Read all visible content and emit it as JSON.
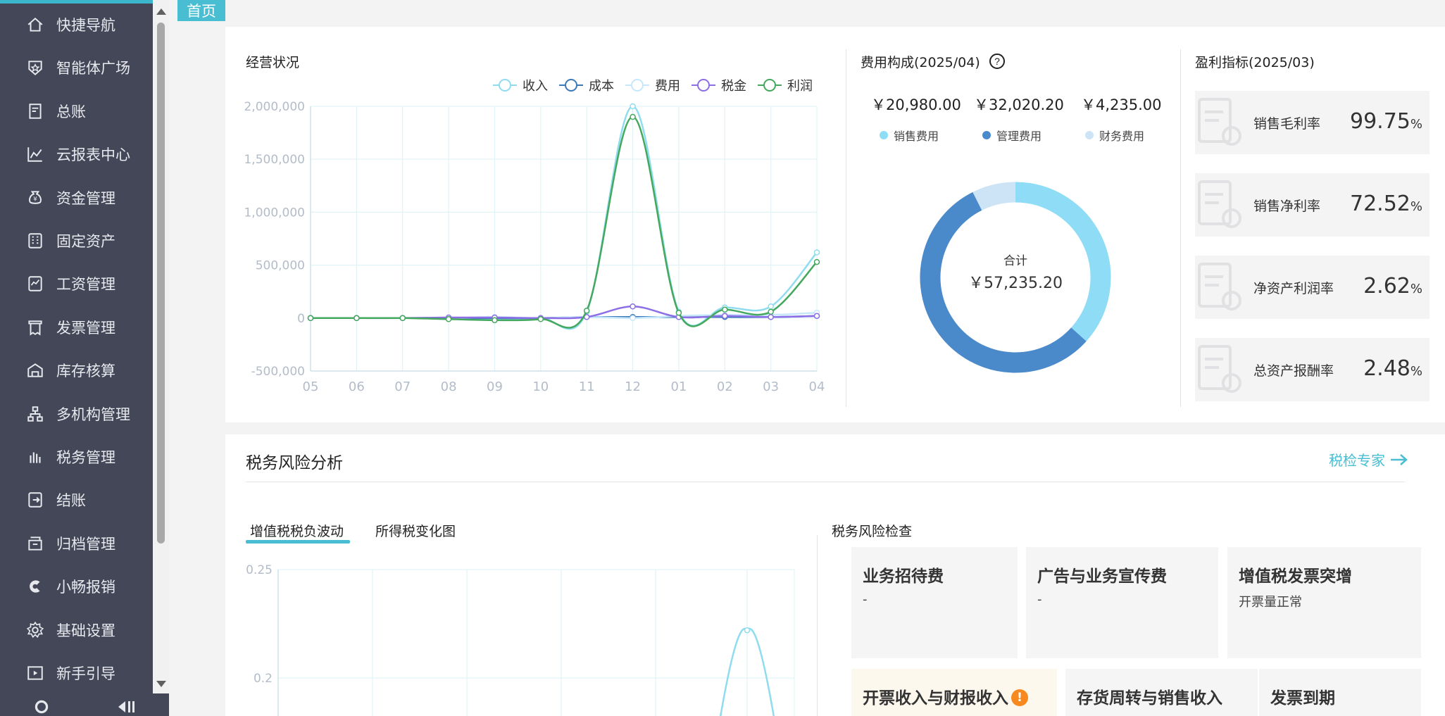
{
  "sidebar": {
    "items": [
      {
        "label": "快捷导航",
        "icon": "home-icon"
      },
      {
        "label": "智能体广场",
        "icon": "star-shield-icon"
      },
      {
        "label": "总账",
        "icon": "ledger-icon"
      },
      {
        "label": "云报表中心",
        "icon": "chart-line-icon"
      },
      {
        "label": "资金管理",
        "icon": "money-bag-icon"
      },
      {
        "label": "固定资产",
        "icon": "building-icon"
      },
      {
        "label": "工资管理",
        "icon": "payroll-icon"
      },
      {
        "label": "发票管理",
        "icon": "invoice-icon"
      },
      {
        "label": "库存核算",
        "icon": "warehouse-icon"
      },
      {
        "label": "多机构管理",
        "icon": "org-chart-icon"
      },
      {
        "label": "税务管理",
        "icon": "tax-hand-icon"
      },
      {
        "label": "结账",
        "icon": "checkout-icon"
      },
      {
        "label": "归档管理",
        "icon": "archive-icon"
      },
      {
        "label": "小畅报销",
        "icon": "reimburse-icon"
      },
      {
        "label": "基础设置",
        "icon": "settings-icon"
      },
      {
        "label": "新手引导",
        "icon": "video-guide-icon"
      }
    ]
  },
  "tabs": {
    "home": "首页"
  },
  "business": {
    "title": "经营状况",
    "chart_data": {
      "type": "line",
      "categories": [
        "05",
        "06",
        "07",
        "08",
        "09",
        "10",
        "11",
        "12",
        "01",
        "02",
        "03",
        "04"
      ],
      "y_ticks": [
        "2,000,000",
        "1,500,000",
        "1,000,000",
        "500,000",
        "0",
        "-500,000"
      ],
      "ylim": [
        -500000,
        2000000
      ],
      "series": [
        {
          "name": "收入",
          "color": "#8fdcef",
          "values": [
            0,
            0,
            0,
            0,
            -10000,
            0,
            60000,
            2000000,
            60000,
            100000,
            110000,
            620000
          ]
        },
        {
          "name": "成本",
          "color": "#3b79b9",
          "values": [
            0,
            0,
            0,
            0,
            0,
            0,
            10000,
            10000,
            10000,
            10000,
            10000,
            20000
          ]
        },
        {
          "name": "费用",
          "color": "#c6e7fb",
          "values": [
            0,
            0,
            0,
            0,
            10000,
            0,
            10000,
            0,
            20000,
            30000,
            30000,
            50000
          ]
        },
        {
          "name": "税金",
          "color": "#8c6fe6",
          "values": [
            0,
            0,
            0,
            5000,
            5000,
            0,
            10000,
            110000,
            10000,
            20000,
            10000,
            20000
          ]
        },
        {
          "name": "利润",
          "color": "#44a85e",
          "values": [
            0,
            0,
            0,
            -10000,
            -20000,
            -10000,
            70000,
            1900000,
            50000,
            80000,
            60000,
            530000
          ]
        }
      ]
    }
  },
  "fee": {
    "title": "费用构成(2025/04)",
    "values": [
      "￥20,980.00",
      "￥32,020.20",
      "￥4,235.00"
    ],
    "legend": [
      "销售费用",
      "管理费用",
      "财务费用"
    ],
    "total_label": "合计",
    "total_value": "￥57,235.20",
    "chart_data": {
      "type": "pie",
      "labels": [
        "销售费用",
        "管理费用",
        "财务费用"
      ],
      "values": [
        20980.0,
        32020.2,
        4235.0
      ],
      "colors": [
        "#8fdcf7",
        "#4a8acb",
        "#cde4f7"
      ]
    }
  },
  "profit": {
    "title": "盈利指标(2025/03)",
    "cards": [
      {
        "name": "销售毛利率",
        "value": "99.75",
        "unit": "%"
      },
      {
        "name": "销售净利率",
        "value": "72.52",
        "unit": "%"
      },
      {
        "name": "净资产利润率",
        "value": "2.62",
        "unit": "%"
      },
      {
        "name": "总资产报酬率",
        "value": "2.48",
        "unit": "%"
      }
    ]
  },
  "tax": {
    "title": "税务风险分析",
    "expert_link": "税检专家",
    "tabs": [
      "增值税税负波动",
      "所得税变化图"
    ],
    "chart_data": {
      "type": "line",
      "y_ticks": [
        "0.25",
        "0.2"
      ],
      "ylim": [
        0.15,
        0.25
      ],
      "series": [
        {
          "color": "#8fdcef",
          "values": [
            0.222
          ]
        }
      ]
    },
    "risk_title": "税务风险检查",
    "risk_cards": [
      {
        "title": "业务招待费",
        "sub": "-"
      },
      {
        "title": "广告与业务宣传费",
        "sub": "-"
      },
      {
        "title": "增值税发票突增",
        "sub": "开票量正常"
      },
      {
        "title": "开票收入与财报收入",
        "sub": ""
      },
      {
        "title": "存货周转与销售收入",
        "sub": ""
      },
      {
        "title": "发票到期",
        "sub": ""
      }
    ]
  }
}
